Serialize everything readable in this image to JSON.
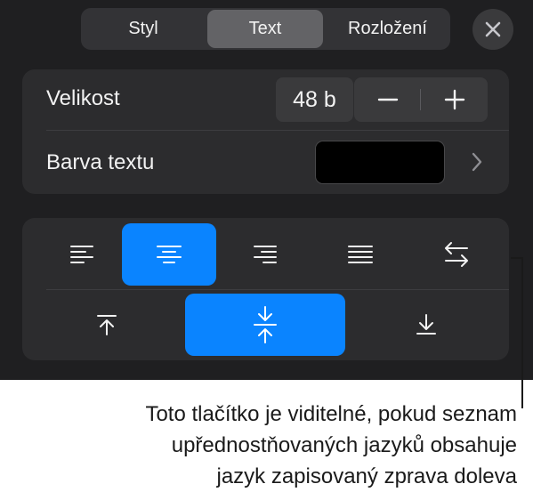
{
  "tabs": [
    {
      "label": "Styl",
      "active": false
    },
    {
      "label": "Text",
      "active": true
    },
    {
      "label": "Rozložení",
      "active": false
    }
  ],
  "close_icon": "close-icon",
  "size": {
    "label": "Velikost",
    "value": "48 b"
  },
  "color": {
    "label": "Barva textu",
    "swatch": "#000000"
  },
  "alignment": {
    "horizontal": [
      "align-left-icon",
      "align-center-icon",
      "align-right-icon",
      "justify-icon",
      "rtl-direction-icon"
    ],
    "horizontal_selected": "align-center-icon",
    "vertical": [
      "align-top-icon",
      "align-middle-icon",
      "align-bottom-icon"
    ],
    "vertical_selected": "align-middle-icon"
  },
  "accent": "#0a84ff",
  "callout": {
    "lines": [
      "Toto tlačítko je viditelné, pokud seznam",
      "upřednostňovaných jazyků obsahuje",
      "jazyk zapisovaný zprava doleva"
    ]
  }
}
